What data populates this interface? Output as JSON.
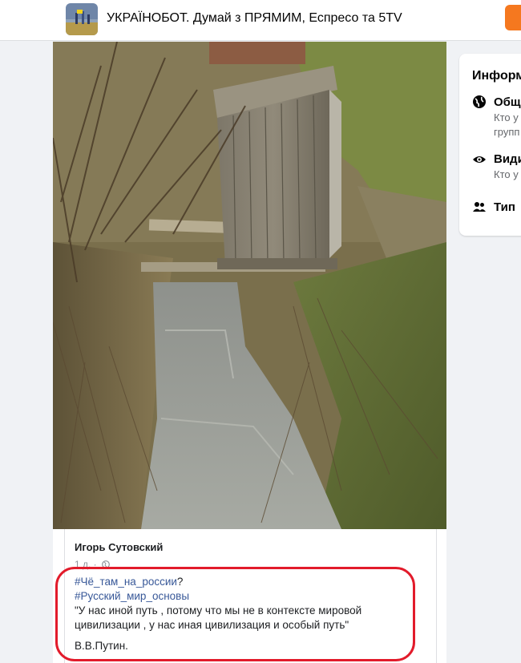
{
  "header": {
    "group_title": "УКРАЇНОБОТ. Думай з ПРЯМИМ, Еспресо та 5TV"
  },
  "post": {
    "author": "Игорь Сутовский",
    "time": "1 д. ·",
    "hashtag_1": "#Чё_там_на_россии",
    "hashtag_1_suffix": "?",
    "hashtag_2": "#Русский_мир_основы",
    "quote_line_1": "\"У нас иной путь , потому что мы не в контексте мировой",
    "quote_line_2": "цивилизации , у нас иная цивилизация и особый путь\"",
    "signature": "В.В.Путин."
  },
  "info_panel": {
    "title": "Информ",
    "row1_title": "Общ",
    "row1_sub_1": "Кто у",
    "row1_sub_2": "групп",
    "row2_title": "Види",
    "row2_sub_1": "Кто у",
    "row3_title": "Тип"
  },
  "colors": {
    "accent_orange": "#f5781f",
    "highlight_red": "#e21b2b",
    "hashtag_blue": "#385898"
  }
}
